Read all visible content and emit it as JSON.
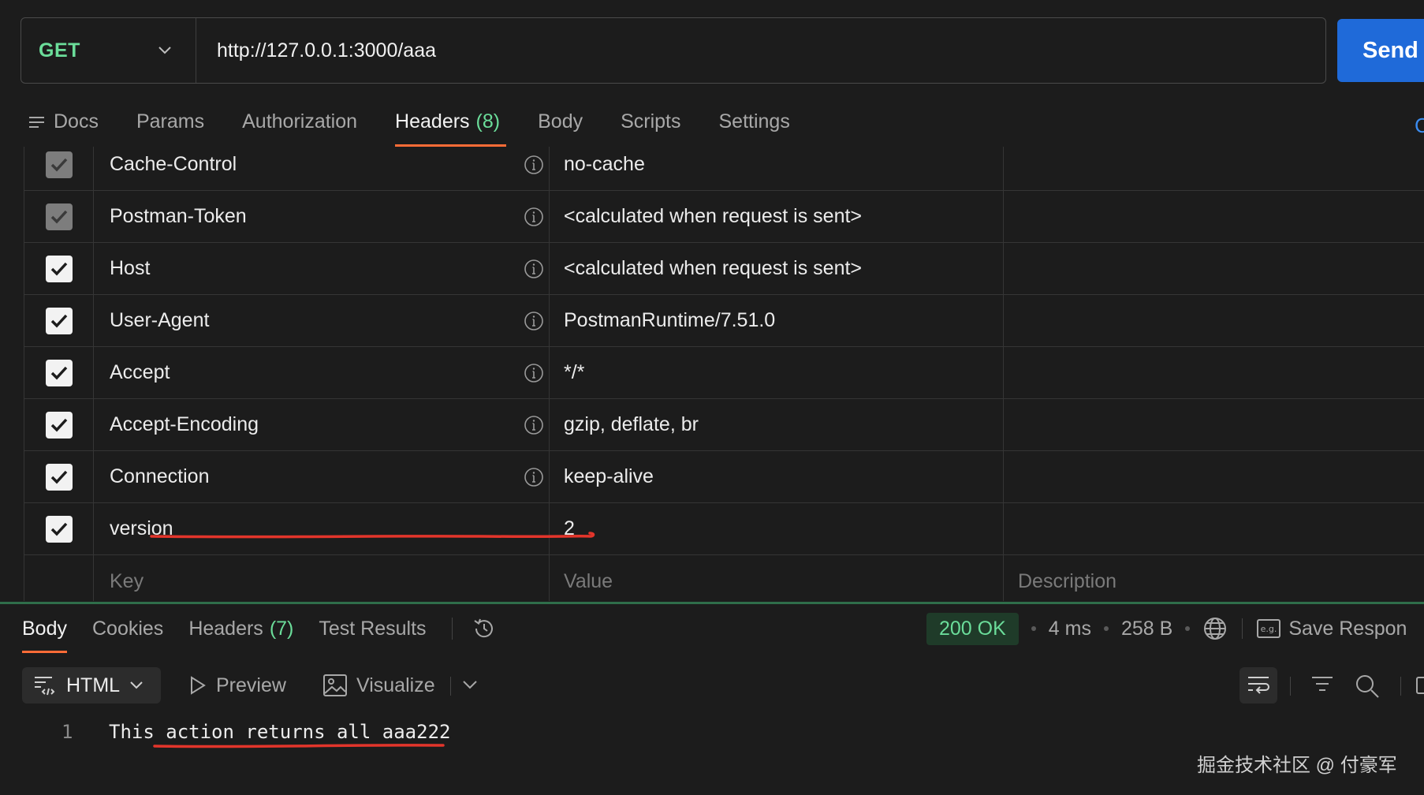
{
  "request": {
    "method": "GET",
    "url": "http://127.0.0.1:3000/aaa",
    "send_label": "Send"
  },
  "request_tabs": {
    "docs": "Docs",
    "params": "Params",
    "authorization": "Authorization",
    "headers": "Headers",
    "headers_count": "(8)",
    "body": "Body",
    "scripts": "Scripts",
    "settings": "Settings",
    "cookies_edge": "C"
  },
  "headers": [
    {
      "key": "Cache-Control",
      "value": "no-cache",
      "checked": true,
      "disabled": true
    },
    {
      "key": "Postman-Token",
      "value": "<calculated when request is sent>",
      "checked": true,
      "disabled": true
    },
    {
      "key": "Host",
      "value": "<calculated when request is sent>",
      "checked": true,
      "disabled": false
    },
    {
      "key": "User-Agent",
      "value": "PostmanRuntime/7.51.0",
      "checked": true,
      "disabled": false
    },
    {
      "key": "Accept",
      "value": "*/*",
      "checked": true,
      "disabled": false
    },
    {
      "key": "Accept-Encoding",
      "value": "gzip, deflate, br",
      "checked": true,
      "disabled": false
    },
    {
      "key": "Connection",
      "value": "keep-alive",
      "checked": true,
      "disabled": false
    },
    {
      "key": "version",
      "value": "2",
      "checked": true,
      "disabled": false
    }
  ],
  "new_header": {
    "key_placeholder": "Key",
    "value_placeholder": "Value",
    "description_placeholder": "Description"
  },
  "response_tabs": {
    "body": "Body",
    "cookies": "Cookies",
    "headers": "Headers",
    "headers_count": "(7)",
    "test_results": "Test Results"
  },
  "response_meta": {
    "status": "200 OK",
    "time": "4 ms",
    "size": "258 B",
    "save_label": "Save Respon"
  },
  "response_toolbar": {
    "format": "HTML",
    "preview": "Preview",
    "visualize": "Visualize"
  },
  "response_body": {
    "line_number": "1",
    "text": "This action returns all aaa222"
  },
  "watermark": "掘金技术社区 @ 付豪军",
  "colors": {
    "accent_green": "#6bdd9a",
    "send_blue": "#1f6ad9",
    "tab_underline": "#ff6c37",
    "annotation_red": "#e3352b"
  }
}
